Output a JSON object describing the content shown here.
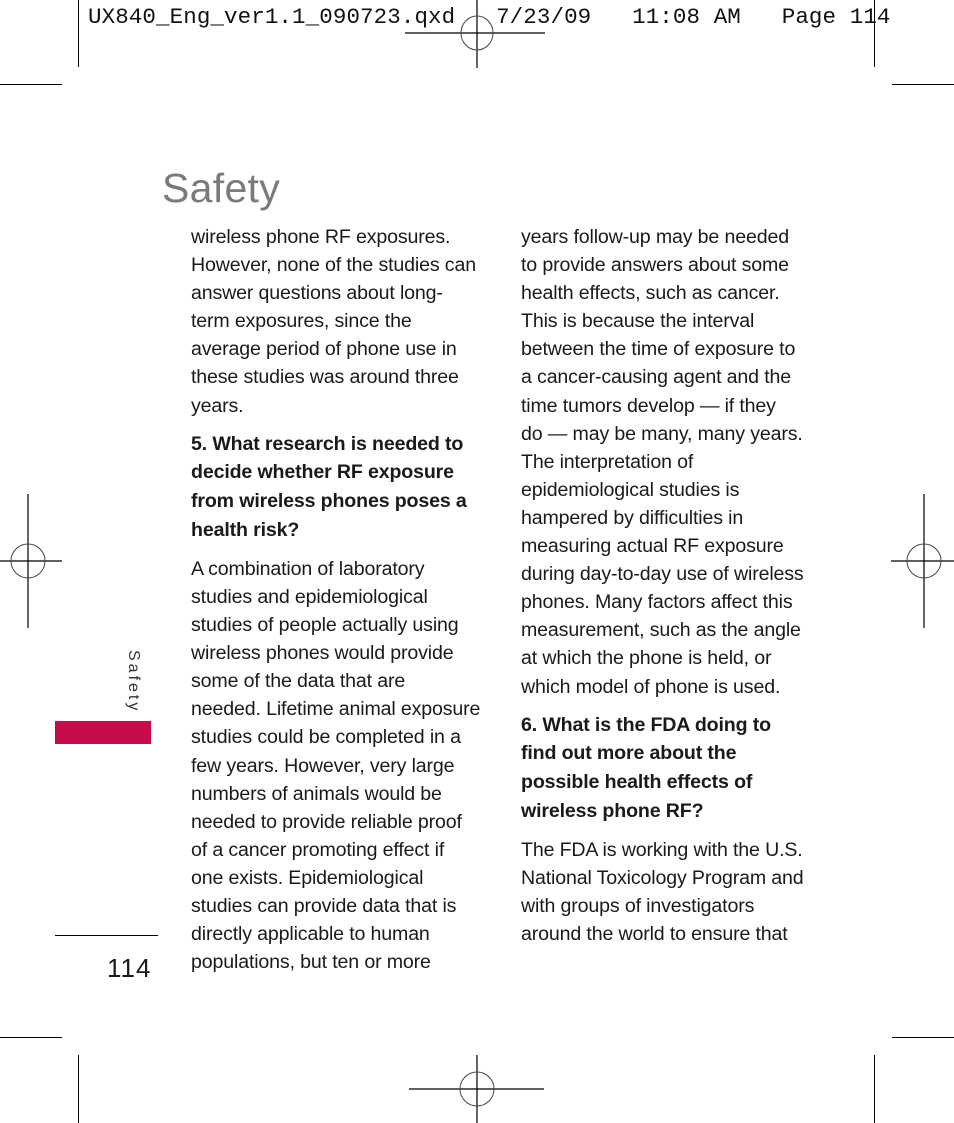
{
  "print_slug": "UX840_Eng_ver1.1_090723.qxd   7/23/09   11:08 AM   Page 114",
  "page": {
    "title": "Safety",
    "side_tab_label": "Safety",
    "side_tab_color": "#c70c4b",
    "page_number": "114"
  },
  "column1": {
    "para1": [
      "wireless phone RF exposures.",
      "However, none of the studies can",
      "answer questions about long-",
      "term exposures, since the",
      "average period of phone use in",
      "these studies was around three",
      "years."
    ],
    "heading5": [
      "5. What research is needed to",
      "decide whether RF exposure",
      "from wireless phones poses a",
      "health risk?"
    ],
    "para2": [
      "A combination of laboratory",
      "studies and epidemiological",
      "studies of people actually using",
      "wireless phones would provide",
      "some of the data that are",
      "needed. Lifetime animal exposure",
      "studies could be completed in a",
      "few years. However, very large",
      "numbers of animals would be",
      "needed to provide reliable proof",
      "of a cancer promoting effect if",
      "one exists. Epidemiological",
      "studies can provide data that is",
      "directly applicable to human",
      "populations, but ten or more"
    ]
  },
  "column2": {
    "para1": [
      "years follow-up may be needed",
      "to provide answers about some",
      "health effects, such as cancer.",
      "This is because the interval",
      "between the time of exposure to",
      "a cancer-causing agent and the",
      "time tumors develop — if they",
      "do — may be many, many years.",
      "The interpretation of",
      "epidemiological studies is",
      "hampered by difficulties in",
      "measuring actual RF exposure",
      "during day-to-day use of wireless",
      "phones. Many factors affect this",
      "measurement, such as the angle",
      "at which the phone is held, or",
      "which model of phone is used."
    ],
    "heading6": [
      "6. What is the FDA doing to",
      "find out more about the",
      "possible health effects of",
      "wireless phone RF?"
    ],
    "para2": [
      "The FDA is working with the U.S.",
      "National Toxicology Program and",
      "with groups of investigators",
      "around the world to ensure that"
    ]
  }
}
